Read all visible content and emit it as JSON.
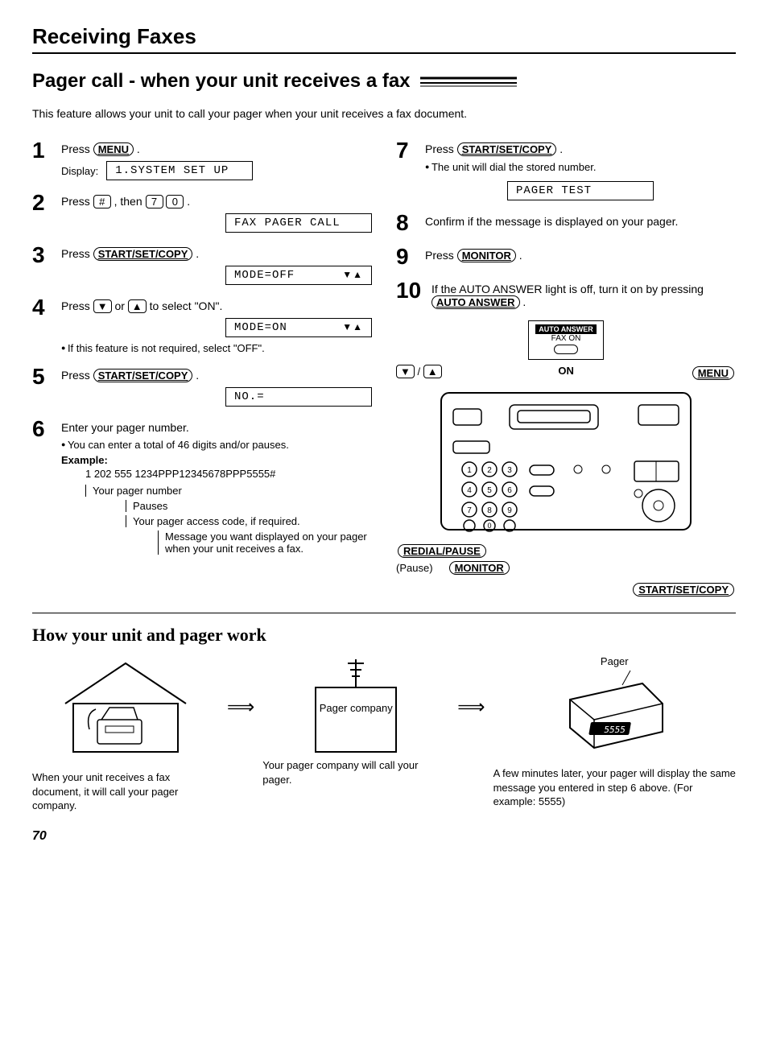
{
  "header": {
    "section": "Receiving Faxes",
    "subtitle": "Pager call - when your unit receives a fax",
    "intro": "This feature allows your unit to call your pager when your unit receives a fax document."
  },
  "buttons": {
    "menu": "MENU",
    "hash": "#",
    "k7": "7",
    "k0": "0",
    "startsetcopy": "START/SET/COPY",
    "down": "▼",
    "up": "▲",
    "monitor": "MONITOR",
    "autoanswer": "AUTO ANSWER",
    "redialpause": "REDIAL/PAUSE"
  },
  "display": {
    "label": "Display:",
    "d1": "1.SYSTEM SET UP",
    "d2": "FAX PAGER CALL",
    "d3": "MODE=OFF",
    "d4": "MODE=ON",
    "d5": "NO.=",
    "d7": "PAGER TEST"
  },
  "steps": {
    "s1a": "Press ",
    "s1b": ".",
    "s2a": "Press ",
    "s2b": ", then ",
    "s2c": ".",
    "s3a": "Press ",
    "s3b": ".",
    "s4a": "Press ",
    "s4b": " or ",
    "s4c": " to select \"ON\".",
    "s4note": "If this feature is not required, select \"OFF\".",
    "s5a": "Press ",
    "s5b": ".",
    "s6a": "Enter your pager number.",
    "s6note": "You can enter a total of 46 digits and/or pauses.",
    "s6example_label": "Example:",
    "s6example": "1 202 555 1234PPP12345678PPP5555#",
    "s6annot1": "Your pager number",
    "s6annot2": "Pauses",
    "s6annot3": "Your pager access code, if required.",
    "s6annot4": "Message you want displayed on your pager when your unit receives a fax.",
    "s7a": "Press ",
    "s7b": ".",
    "s7note": "The unit will dial the stored number.",
    "s8": "Confirm if the message is displayed on your pager.",
    "s9a": "Press ",
    "s9b": ".",
    "s10a": "If the AUTO ANSWER light is off, turn it on by pressing ",
    "s10b": "."
  },
  "device": {
    "autoanswer_label": "AUTO ANSWER",
    "faxon": "FAX ON",
    "arrows": "▼ / ▲",
    "on": "ON",
    "menu": "MENU",
    "redialpause": "REDIAL/PAUSE",
    "pause": "(Pause)",
    "monitor": "MONITOR",
    "startsetcopy": "START/SET/COPY"
  },
  "how": {
    "title": "How your unit and pager work",
    "pager_label": "Pager",
    "pager_company": "Pager company",
    "pager_display": "5555",
    "cap1": "When your unit receives a fax document, it will call your pager company.",
    "cap2": "Your pager company will call your pager.",
    "cap3": "A few minutes later, your pager will display the same message you entered in step 6 above. (For example: 5555)"
  },
  "page_number": "70"
}
